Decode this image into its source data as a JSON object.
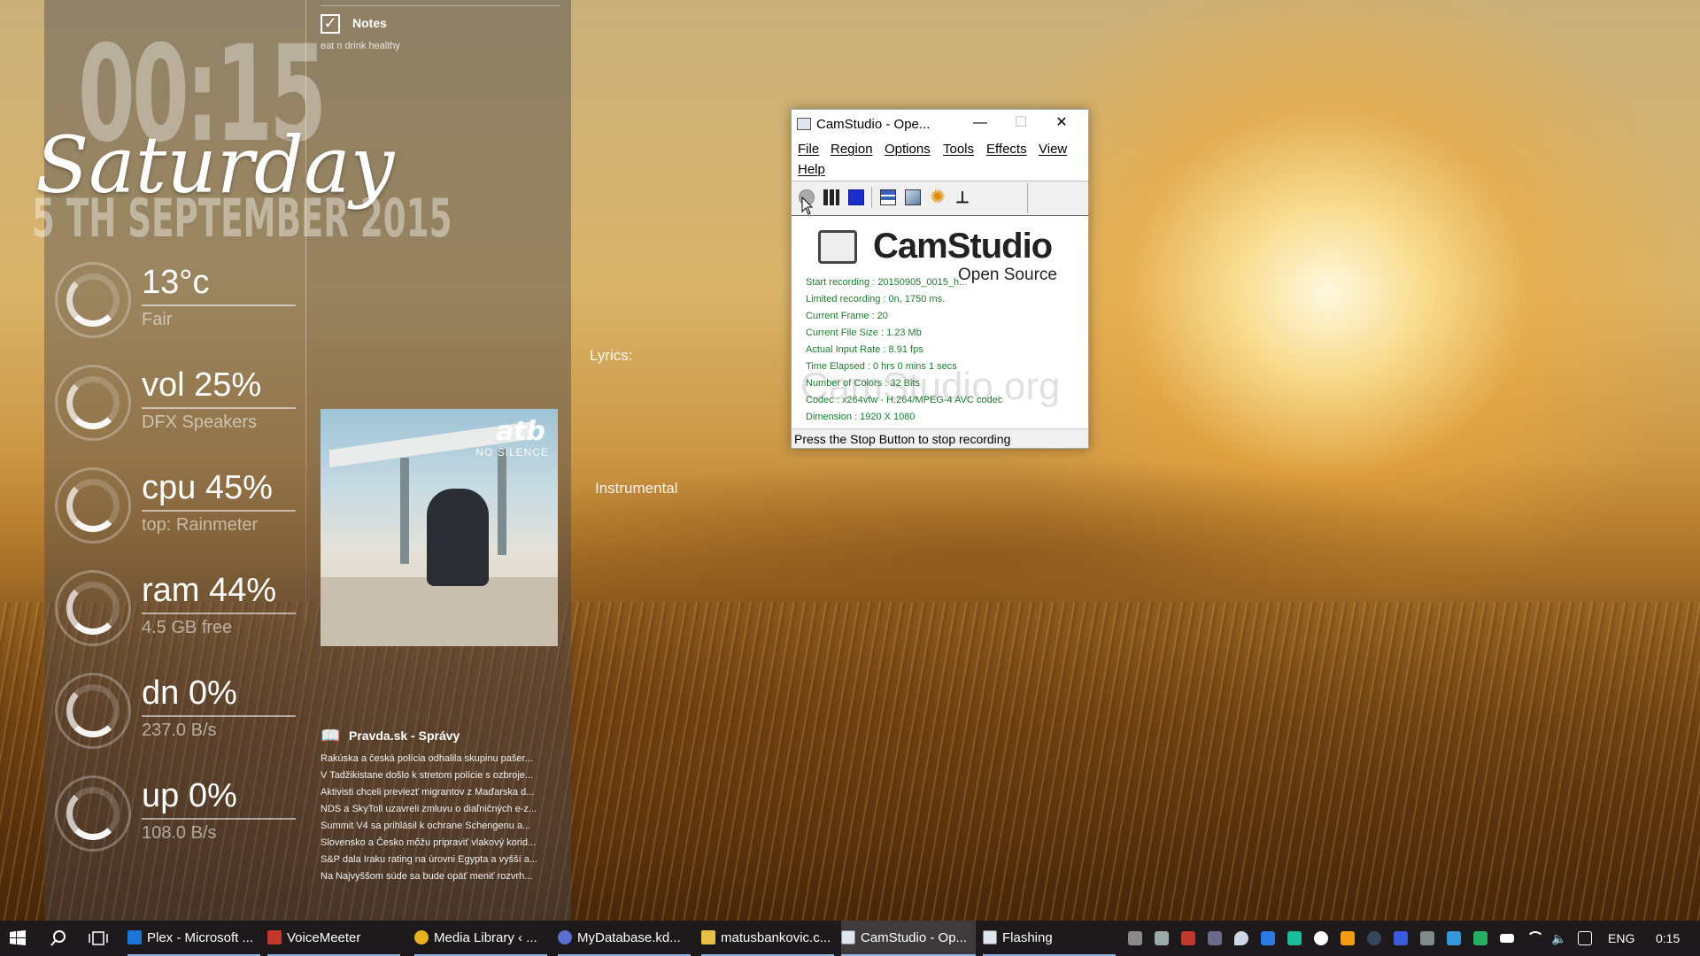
{
  "clock": {
    "time": "00:15",
    "day": "Saturday",
    "date": "5 TH SEPTEMBER 2015"
  },
  "stats": [
    {
      "main": "13°c",
      "sub": "Fair"
    },
    {
      "main": "vol 25%",
      "sub": "DFX Speakers"
    },
    {
      "main": "cpu 45%",
      "sub": "top: Rainmeter"
    },
    {
      "main": "ram 44%",
      "sub": "4.5 GB free"
    },
    {
      "main": "dn 0%",
      "sub": "237.0  B/s"
    },
    {
      "main": "up 0%",
      "sub": "108.0  B/s"
    }
  ],
  "notes": {
    "title": "Notes",
    "text": "eat n drink healthy"
  },
  "player": {
    "lyrics_label": "Lyrics:",
    "lyrics_text": "Instrumental",
    "album_brand": "atb",
    "album_title": "NO SILENCE"
  },
  "feed": {
    "title": "Pravda.sk - Správy",
    "items": [
      "Rakúska a česká polícia odhalila skupinu pašer...",
      "V Tadžikistane došlo k stretom polície s ozbroje...",
      "Aktivisti chceli previezť migrantov z Maďarska d...",
      "NDS a SkyToll uzavreli zmluvu o diaľničných e-z...",
      "Summit V4 sa prihlásil k ochrane Schengenu a...",
      "Slovensko a Česko môžu pripraviť vlakový korid...",
      "S&P dala Iraku rating na úrovni Egypta a vyšší a...",
      "Na Najvyššom súde sa bude opäť meniť rozvrh..."
    ]
  },
  "camstudio": {
    "title": "CamStudio - Ope...",
    "minimize": "—",
    "maximize": "☐",
    "close": "✕",
    "menu": {
      "file": "File",
      "region": "Region",
      "options": "Options",
      "tools": "Tools",
      "effects": "Effects",
      "view": "View",
      "help": "Help"
    },
    "logo_title": "CamStudio",
    "logo_sub": "Open Source",
    "watermark": "CamStudio.org",
    "info": [
      "Start recording : 20150905_0015_h...",
      "Limited recording : 0n, 1750 ms.",
      "Current Frame : 20",
      "Current File Size : 1.23 Mb",
      "Actual Input Rate : 8.91 fps",
      "Time Elapsed : 0 hrs 0 mins 1 secs",
      "Number of Colors : 32 Bits",
      "Codec : x264vfw - H.264/MPEG-4 AVC codec",
      "Dimension : 1920 X 1080"
    ],
    "status": "Press the Stop Button to stop recording",
    "colors": {
      "info_text": "#1e7a2e"
    }
  },
  "taskbar": {
    "tasks": [
      {
        "label": "Plex - Microsoft ...",
        "icon_color": "#1e73d6"
      },
      {
        "label": "VoiceMeeter",
        "icon_color": "#c0392b"
      },
      {
        "label": "Media Library ‹ ...",
        "icon_color": "#e8b21e"
      },
      {
        "label": "MyDatabase.kd...",
        "icon_color": "#5a6fd0"
      },
      {
        "label": "matusbankovic.c...",
        "icon_color": "#e8c048"
      },
      {
        "label": "CamStudio - Op...",
        "icon_color": "#dfe6ee"
      },
      {
        "label": "Flashing",
        "icon_color": "#dfe6ee"
      }
    ],
    "language": "ENG",
    "clock": "0:15",
    "icons": {
      "start": "windows-icon",
      "search": "search-icon",
      "task_view": "task-view-icon"
    }
  }
}
